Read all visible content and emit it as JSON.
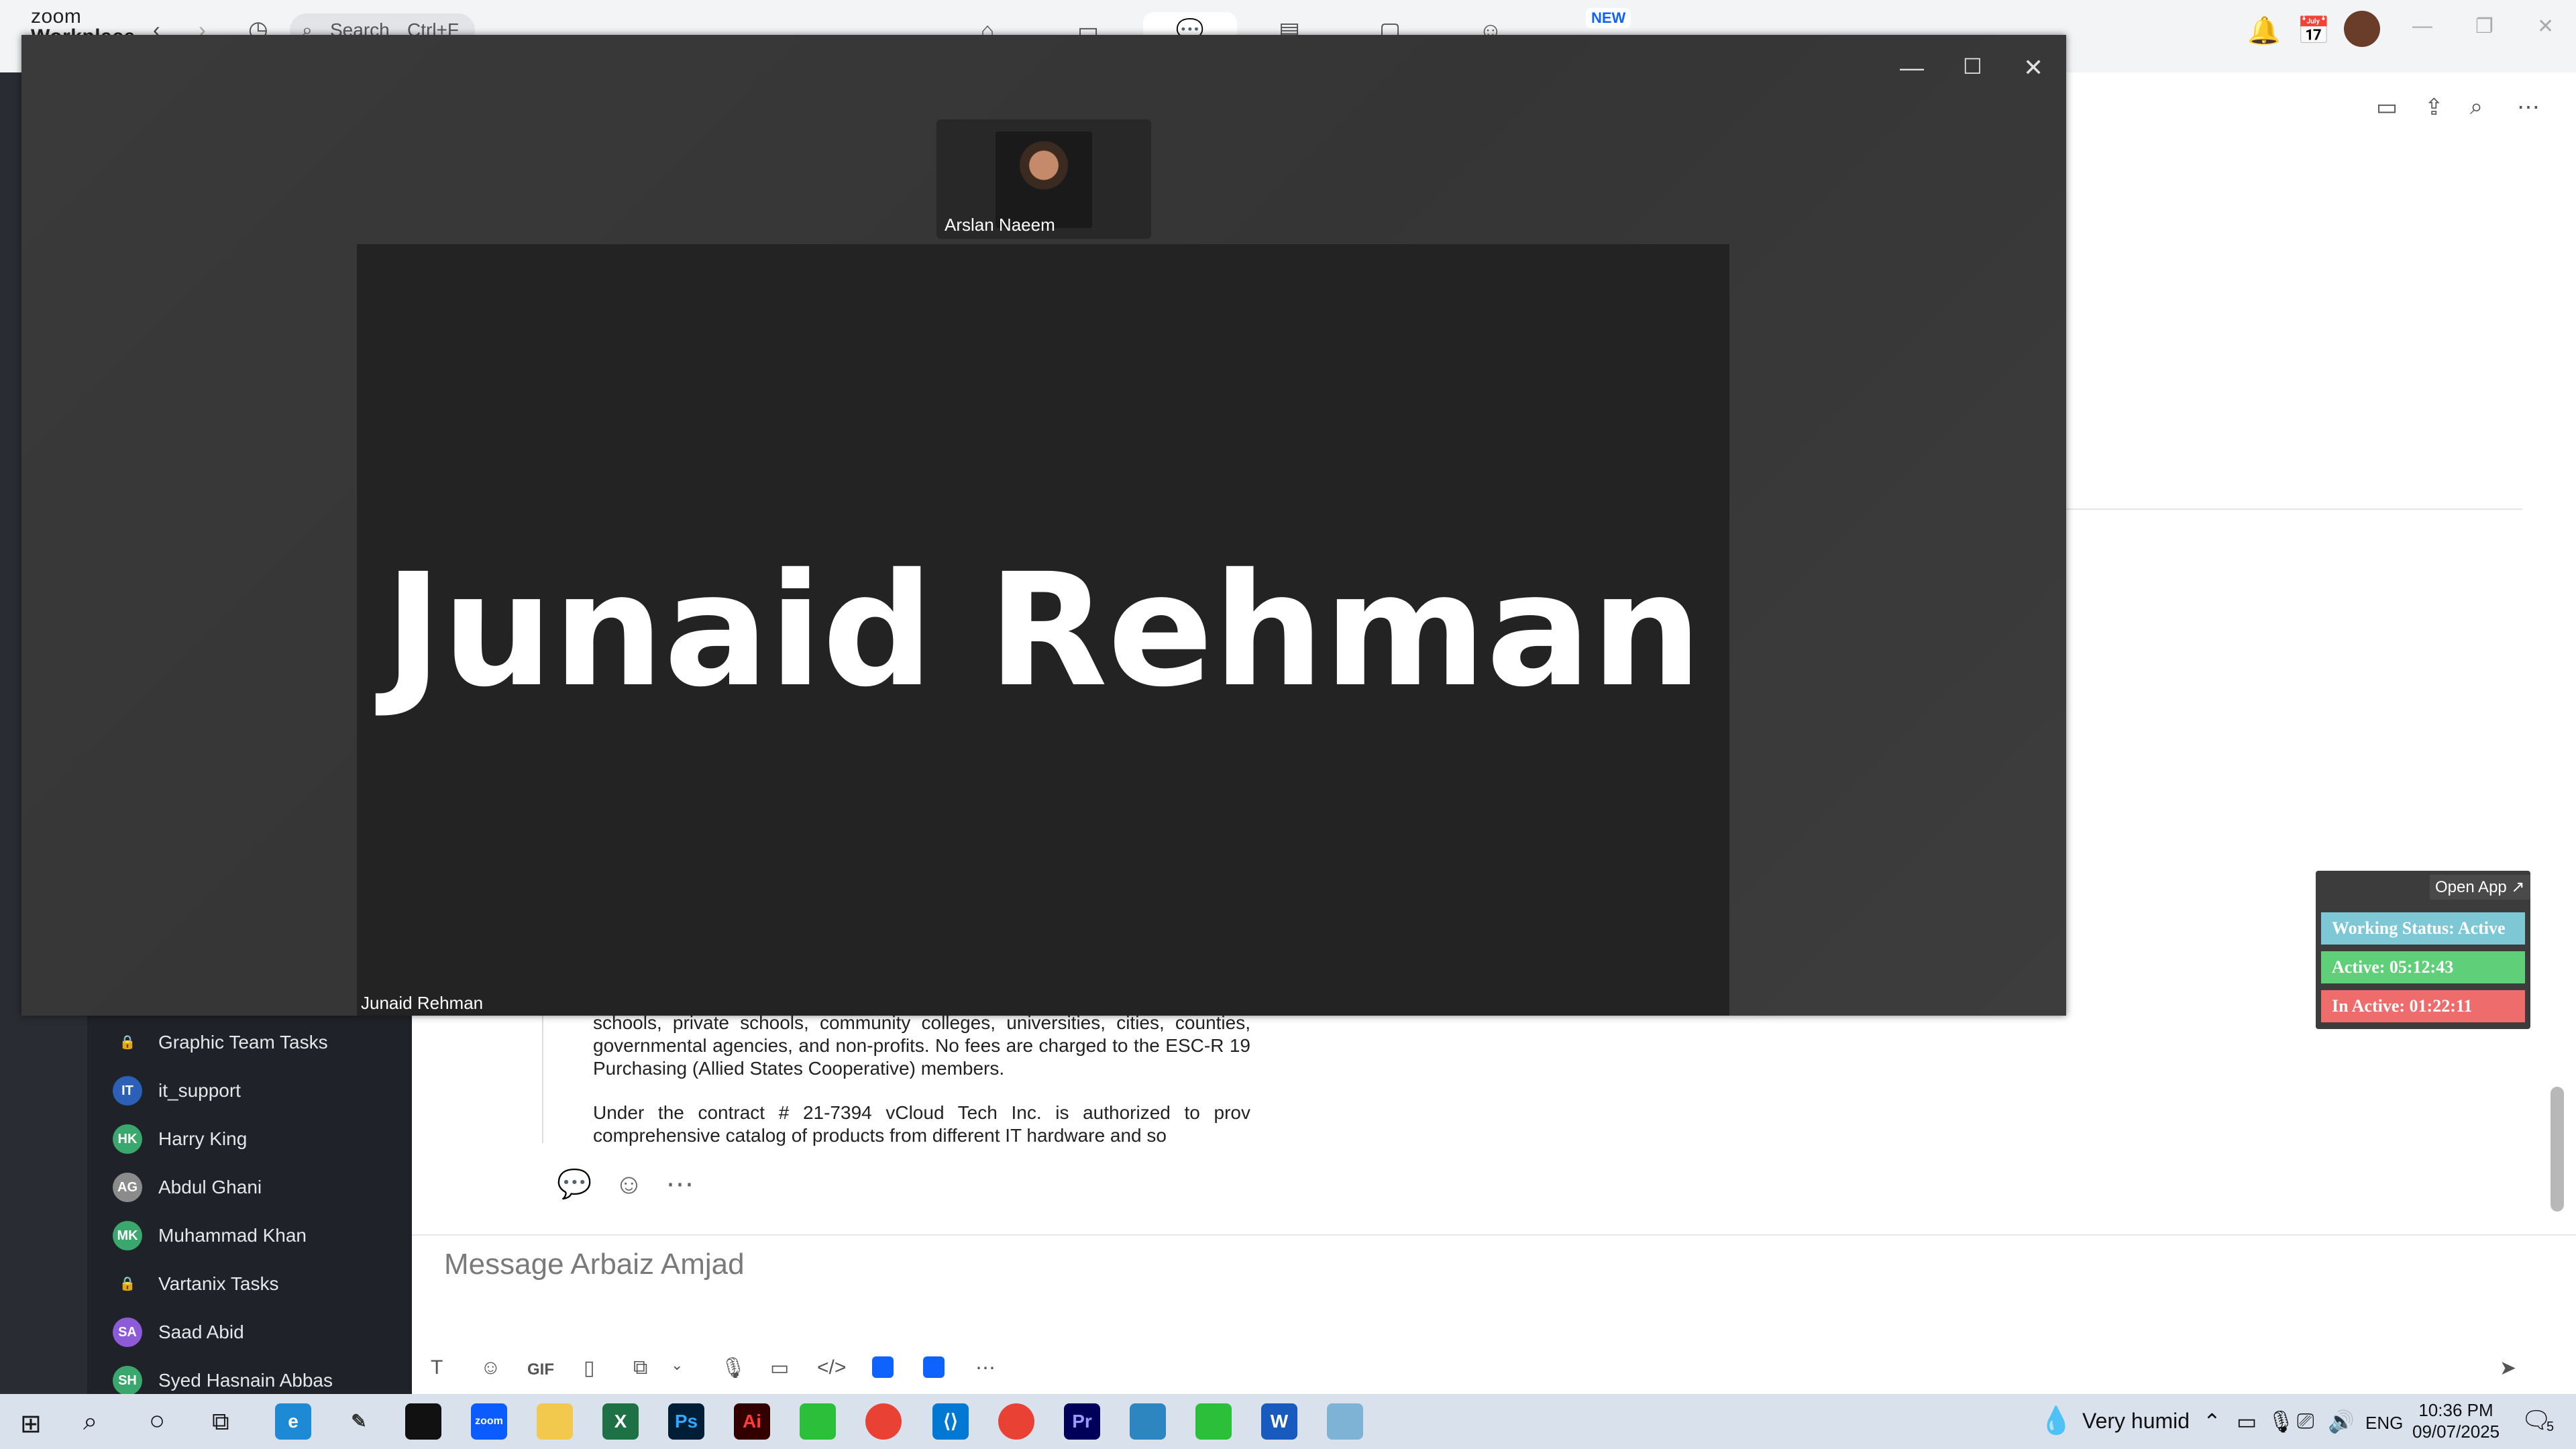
{
  "app": {
    "brand_line1": "zoom",
    "brand_line2": "Workplace",
    "search_placeholder": "Search",
    "search_shortcut": "Ctrl+F",
    "new_badge": "NEW"
  },
  "channels": [
    {
      "name": "Graphic Team Tasks",
      "avatar": "🔒",
      "color": "#1f2228"
    },
    {
      "name": "it_support",
      "avatar": "IT",
      "color": "#2b5fb8"
    },
    {
      "name": "Harry King",
      "avatar": "HK",
      "color": "#3aa76d"
    },
    {
      "name": "Abdul Ghani",
      "avatar": "AG",
      "color": "#8b8b8b"
    },
    {
      "name": "Muhammad Khan",
      "avatar": "MK",
      "color": "#3aa76d"
    },
    {
      "name": "Vartanix Tasks",
      "avatar": "🔒",
      "color": "#1f2228"
    },
    {
      "name": "Saad Abid",
      "avatar": "SA",
      "color": "#8e5bd8"
    },
    {
      "name": "Syed Hasnain Abbas",
      "avatar": "SH",
      "color": "#3aa76d"
    }
  ],
  "message": {
    "para1": "schools, private schools, community colleges, universities, cities, counties, governmental agencies, and non-profits. No fees are charged to the ESC-R 19 Purchasing (Allied States Cooperative) members.",
    "para2": "Under the contract # 21-7394 vCloud Tech Inc. is authorized to prov comprehensive catalog of products from different IT hardware and so"
  },
  "composer": {
    "placeholder": "Message Arbaiz Amjad",
    "gif_label": "GIF"
  },
  "status_widget": {
    "open_app": "Open App ↗",
    "working": "Working Status: Active",
    "active": "Active: 05:12:43",
    "inactive": "In Active: 01:22:11",
    "colors": {
      "working": "#7ec8d6",
      "active": "#5fcf79",
      "inactive": "#ee6c6c"
    }
  },
  "meeting": {
    "thumb_name": "Arslan Naeem",
    "speaker_display": "Junaid Rehman",
    "speaker_label": "Junaid Rehman"
  },
  "taskbar": {
    "weather": "Very humid",
    "lang": "ENG",
    "time": "10:36 PM",
    "date": "09/07/2025",
    "notif_count": "5"
  }
}
